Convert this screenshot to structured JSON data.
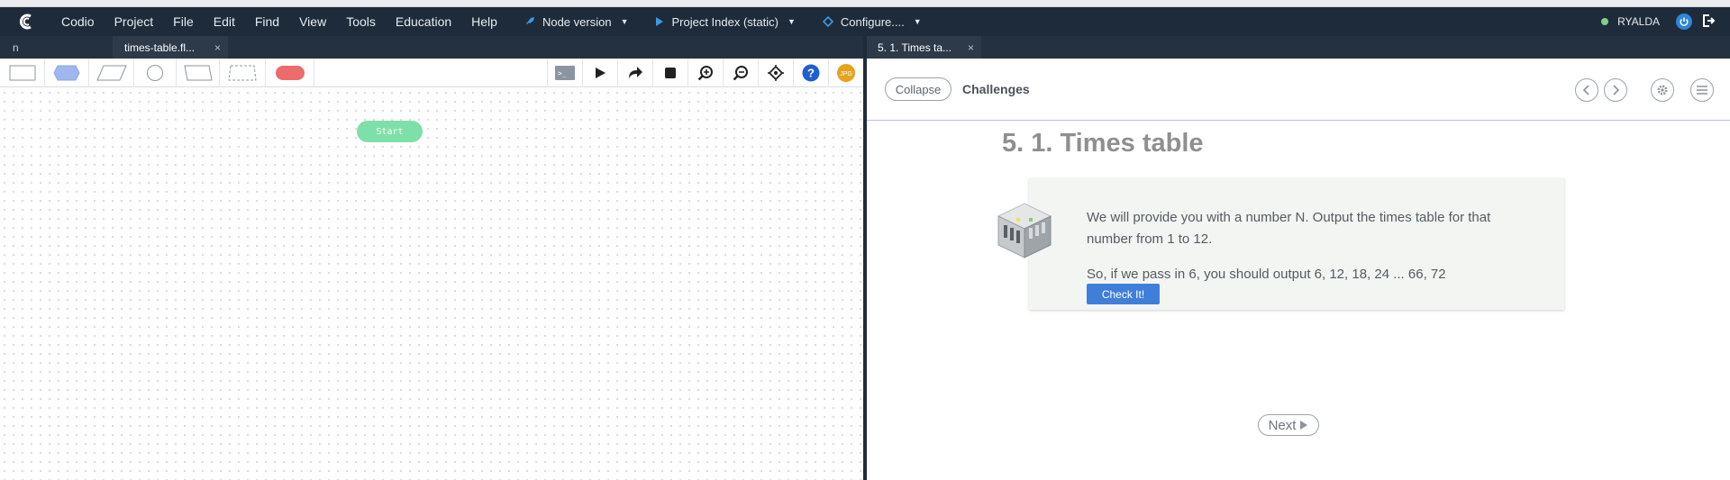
{
  "menubar": {
    "logo": "codio-logo-icon",
    "items": [
      "Codio",
      "Project",
      "File",
      "Edit",
      "Find",
      "View",
      "Tools",
      "Education",
      "Help"
    ],
    "tools": [
      {
        "label": "Node version",
        "icon": "rocket-icon"
      },
      {
        "label": "Project Index (static)",
        "icon": "play-icon"
      },
      {
        "label": "Configure....",
        "icon": "diamond-icon"
      }
    ],
    "user": "RYALDA",
    "status_color": "#7ed08b"
  },
  "left": {
    "tabs": [
      {
        "label": "n"
      },
      {
        "label": "times-table.fl...",
        "close": "×"
      }
    ],
    "shapes": [
      "process-shape",
      "preparation-shape",
      "data-shape",
      "connector-shape",
      "manual-input-shape",
      "dashed-shape",
      "terminator-shape"
    ],
    "actions": [
      "terminal-icon",
      "run-icon",
      "step-icon",
      "stop-icon",
      "zoom-in-icon",
      "zoom-out-icon",
      "locate-icon",
      "help-icon",
      "avatar-icon"
    ],
    "avatar_text": "JPG",
    "start_label": "Start"
  },
  "right": {
    "tab": {
      "label": "5. 1. Times ta...",
      "close": "×"
    },
    "collapse": "Collapse",
    "title": "Challenges",
    "heading": "5. 1. Times table",
    "challenge": {
      "line1": "We will provide you with a number N. Output the times table for that number from 1 to 12.",
      "line2": "So, if we pass in 6, you should output 6, 12, 18, 24 ... 66, 72",
      "button": "Check It!"
    },
    "next": "Next"
  },
  "colors": {
    "menubar": "#1e2b3a",
    "start_node": "#7ee0a8",
    "terminator": "#ec6b6b",
    "check_button": "#3f7fd9"
  }
}
